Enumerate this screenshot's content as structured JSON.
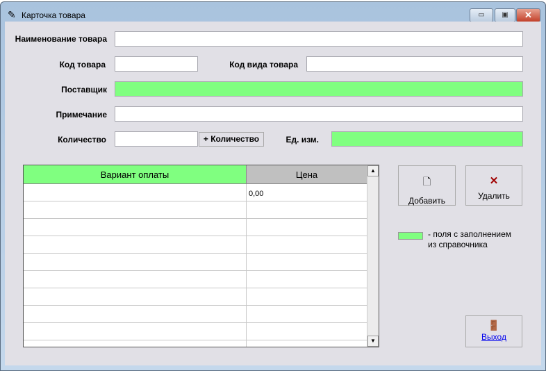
{
  "window": {
    "title": "Карточка товара",
    "minimize": "▭",
    "maximize": "▣",
    "close": "✕"
  },
  "labels": {
    "name": "Наименование товара",
    "code": "Код товара",
    "type_code": "Код вида товара",
    "supplier": "Поставщик",
    "note": "Примечание",
    "quantity": "Количество",
    "unit": "Ед. изм."
  },
  "fields": {
    "name": "",
    "code": "",
    "type_code": "",
    "supplier": "",
    "note": "",
    "quantity": "",
    "unit": ""
  },
  "buttons": {
    "add_quantity": "+ Количество",
    "add": "Добавить",
    "delete": "Удалить",
    "exit": "Выход"
  },
  "table": {
    "columns": [
      "Вариант оплаты",
      "Цена"
    ],
    "rows": [
      [
        "",
        "0,00"
      ],
      [
        "",
        ""
      ],
      [
        "",
        ""
      ],
      [
        "",
        ""
      ],
      [
        "",
        ""
      ],
      [
        "",
        ""
      ],
      [
        "",
        ""
      ],
      [
        "",
        ""
      ],
      [
        "",
        ""
      ],
      [
        "",
        ""
      ]
    ]
  },
  "legend": {
    "line1": "- поля с заполнением",
    "line2": "из справочника"
  },
  "colors": {
    "lookup_field": "#80ff80"
  }
}
